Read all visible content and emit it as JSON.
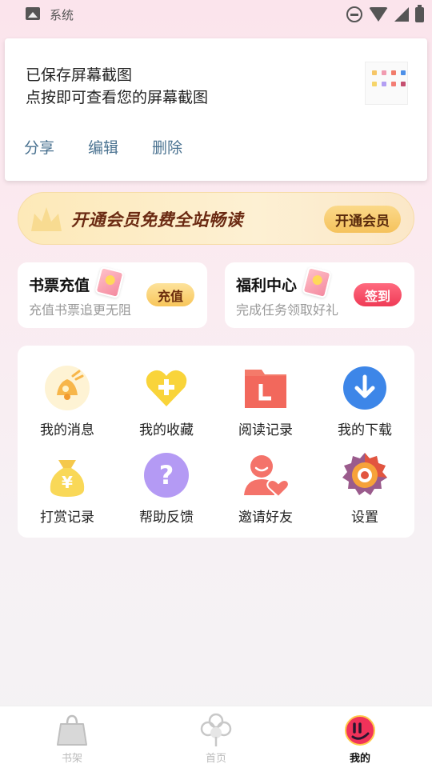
{
  "status_bar": {
    "app_label": "系统"
  },
  "notification": {
    "title": "已保存屏幕截图",
    "subtitle": "点按即可查看您的屏幕截图",
    "actions": [
      "分享",
      "编辑",
      "删除"
    ],
    "action_color": "#4a7290"
  },
  "vip_banner": {
    "text": "开通会员免费全站畅读",
    "button_label": "开通会员"
  },
  "cards": {
    "recharge": {
      "title": "书票充值",
      "desc": "充值书票追更无阻",
      "button_label": "充值"
    },
    "welfare": {
      "title": "福利中心",
      "desc": "完成任务领取好礼",
      "button_label": "签到"
    }
  },
  "menu": [
    {
      "label": "我的消息",
      "icon": "bell-icon"
    },
    {
      "label": "我的收藏",
      "icon": "heart-plus-icon"
    },
    {
      "label": "阅读记录",
      "icon": "folder-icon"
    },
    {
      "label": "我的下载",
      "icon": "download-icon"
    },
    {
      "label": "打赏记录",
      "icon": "money-bag-icon"
    },
    {
      "label": "帮助反馈",
      "icon": "help-icon"
    },
    {
      "label": "邀请好友",
      "icon": "invite-friend-icon"
    },
    {
      "label": "设置",
      "icon": "gear-icon"
    }
  ],
  "tabbar": {
    "tabs": [
      {
        "label": "书架",
        "icon": "bookshelf-icon",
        "active": false
      },
      {
        "label": "首页",
        "icon": "home-clover-icon",
        "active": false
      },
      {
        "label": "我的",
        "icon": "profile-icon",
        "active": true
      }
    ]
  },
  "colors": {
    "accent_red": "#ef3b56",
    "gold": "#f8c65a",
    "brown_text": "#6b2a12"
  }
}
